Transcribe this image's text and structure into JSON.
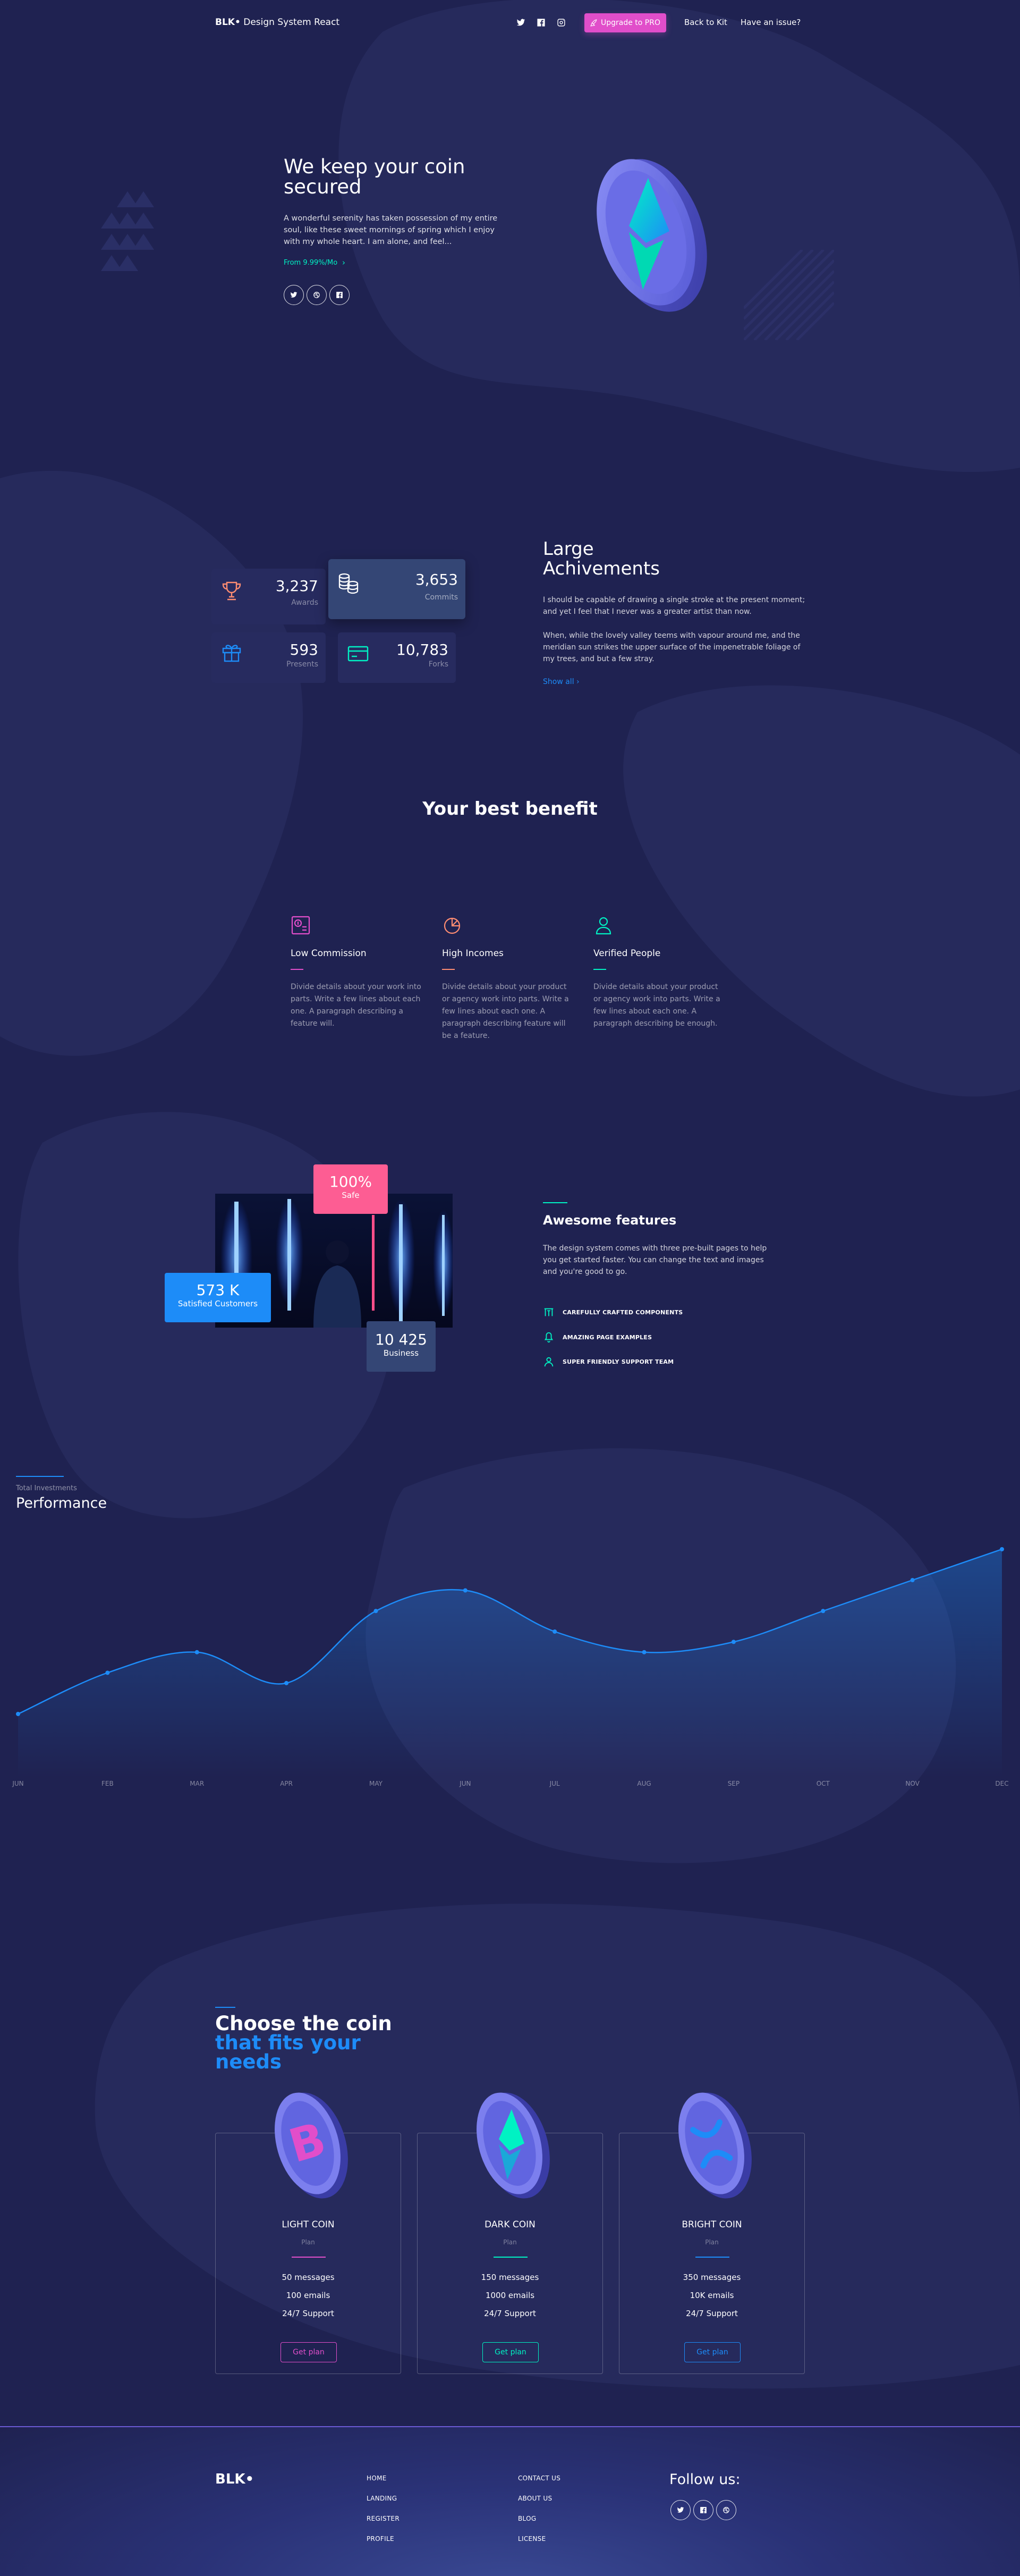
{
  "navbar": {
    "brand_bold": "BLK•",
    "brand_rest": " Design System React",
    "icons": [
      "twitter-icon",
      "facebook-icon",
      "instagram-icon"
    ],
    "upgrade_label": "Upgrade to PRO",
    "back_label": "Back to Kit",
    "issue_label": "Have an issue?"
  },
  "hero": {
    "title": "We keep your coin secured",
    "text": "A wonderful serenity has taken possession of my entire soul, like these sweet mornings of spring which I enjoy with my whole heart. I am alone, and feel...",
    "from_label": "From 9.99%/Mo"
  },
  "stats": [
    {
      "value": "3,237",
      "label": "Awards",
      "icon": "trophy-icon"
    },
    {
      "value": "3,653",
      "label": "Commits",
      "icon": "coins-icon"
    },
    {
      "value": "593",
      "label": "Presents",
      "icon": "gift-icon"
    },
    {
      "value": "10,783",
      "label": "Forks",
      "icon": "credit-card-icon"
    }
  ],
  "achievements": {
    "title_line1": "Large",
    "title_line2": "Achivements",
    "p1": "I should be capable of drawing a single stroke at the present moment; and yet I feel that I never was a greater artist than now.",
    "p2": "When, while the lovely valley teems with vapour around me, and the meridian sun strikes the upper surface of the impenetrable foliage of my trees, and but a few stray.",
    "show_all": "Show all"
  },
  "benefit": {
    "title": "Your best benefit",
    "items": [
      {
        "title": "Low Commission",
        "text": "Divide details about your work into parts. Write a few lines about each one. A paragraph describing a feature will.",
        "icon": "money-coins-icon",
        "color": "#e14eca"
      },
      {
        "title": "High Incomes",
        "text": "Divide details about your product or agency work into parts. Write a few lines about each one. A paragraph describing feature will be a feature.",
        "icon": "chart-pie-icon",
        "color": "#ff8d72"
      },
      {
        "title": "Verified People",
        "text": "Divide details about your product or agency work into parts. Write a few lines about each one. A paragraph describing be enough.",
        "icon": "single-user-icon",
        "color": "#00f2c3"
      }
    ]
  },
  "features": {
    "badge_safe_value": "100%",
    "badge_safe_label": "Safe",
    "badge_customers_value": "573 K",
    "badge_customers_label": "Satisfied Customers",
    "badge_business_value": "10 425",
    "badge_business_label": "Business",
    "title": "Awesome features",
    "text": "The design system comes with three pre-built pages to help you get started faster. You can change the text and images and you're good to go.",
    "items": [
      {
        "label": "CAREFULLY CRAFTED COMPONENTS",
        "icon": "components-icon"
      },
      {
        "label": "AMAZING PAGE EXAMPLES",
        "icon": "bell-icon"
      },
      {
        "label": "SUPER FRIENDLY SUPPORT TEAM",
        "icon": "support-user-icon"
      }
    ]
  },
  "performance": {
    "subtitle": "Total Investments",
    "title": "Performance"
  },
  "chart_data": {
    "type": "line",
    "title": "Performance",
    "categories": [
      "JUN",
      "FEB",
      "MAR",
      "APR",
      "MAY",
      "JUN",
      "JUL",
      "AUG",
      "SEP",
      "OCT",
      "NOV",
      "DEC"
    ],
    "series": [
      {
        "values": [
          0,
          20,
          30,
          15,
          50,
          60,
          40,
          30,
          35,
          50,
          65,
          80
        ]
      }
    ],
    "ylim": [
      0,
      80
    ],
    "grid": false,
    "line_color": "#1d8cf8"
  },
  "pricing": {
    "title_main": "Choose the coin ",
    "title_highlight": "that fits your needs",
    "plans": [
      {
        "name": "LIGHT COIN",
        "sub": "Plan",
        "features": [
          "50 messages",
          "100 emails",
          "24/7 Support"
        ],
        "button": "Get plan",
        "color": "#e14eca",
        "coin": "bitcoin-coin-icon"
      },
      {
        "name": "DARK COIN",
        "sub": "Plan",
        "features": [
          "150 messages",
          "1000 emails",
          "24/7 Support"
        ],
        "button": "Get plan",
        "color": "#00f2c3",
        "coin": "ethereum-coin-icon"
      },
      {
        "name": "BRIGHT COIN",
        "sub": "Plan",
        "features": [
          "350 messages",
          "10K emails",
          "24/7 Support"
        ],
        "button": "Get plan",
        "color": "#1d8cf8",
        "coin": "ripple-coin-icon"
      }
    ]
  },
  "footer": {
    "brand": "BLK•",
    "col1": [
      "HOME",
      "LANDING",
      "REGISTER",
      "PROFILE"
    ],
    "col2": [
      "CONTACT US",
      "ABOUT US",
      "BLOG",
      "LICENSE"
    ],
    "follow_title": "Follow us:"
  }
}
